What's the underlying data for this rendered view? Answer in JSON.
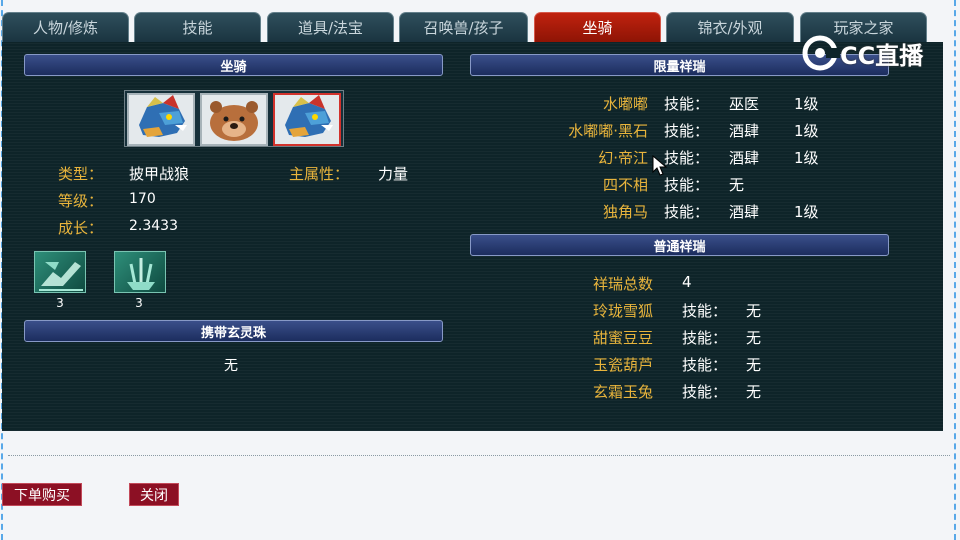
{
  "tabs": [
    {
      "label": "人物/修炼"
    },
    {
      "label": "技能"
    },
    {
      "label": "道具/法宝"
    },
    {
      "label": "召唤兽/孩子"
    },
    {
      "label": "坐骑",
      "active": true
    },
    {
      "label": "锦衣/外观"
    },
    {
      "label": "玩家之家"
    }
  ],
  "logo": {
    "text": "CC直播",
    "icon": "cc-logo-icon"
  },
  "mount_section": {
    "header": "坐骑",
    "mount_icons": [
      "dragon-wolf-portrait-icon",
      "bear-portrait-icon",
      "dragon-wolf-portrait-icon"
    ],
    "type_label": "类型：",
    "type_value": "披甲战狼",
    "main_attr_label": "主属性：",
    "main_attr_value": "力量",
    "level_label": "等级：",
    "level_value": "170",
    "growth_label": "成长：",
    "growth_value": "2.3433",
    "skills": [
      {
        "icon": "mount-skill-1-icon",
        "count": "3"
      },
      {
        "icon": "mount-skill-2-icon",
        "count": "3"
      }
    ]
  },
  "xuanling_section": {
    "header": "携带玄灵珠",
    "value": "无"
  },
  "limited_section": {
    "header": "限量祥瑞",
    "rows": [
      {
        "name": "水嘟嘟",
        "skill_label": "技能：",
        "skill": "巫医",
        "level": "1级"
      },
      {
        "name": "水嘟嘟·黑石",
        "skill_label": "技能：",
        "skill": "酒肆",
        "level": "1级"
      },
      {
        "name": "幻·帝江",
        "skill_label": "技能：",
        "skill": "酒肆",
        "level": "1级"
      },
      {
        "name": "四不相",
        "skill_label": "技能：",
        "skill": "无",
        "level": ""
      },
      {
        "name": "独角马",
        "skill_label": "技能：",
        "skill": "酒肆",
        "level": "1级"
      }
    ]
  },
  "normal_section": {
    "header": "普通祥瑞",
    "total_label": "祥瑞总数",
    "total_value": "4",
    "rows": [
      {
        "name": "玲珑雪狐",
        "skill_label": "技能：",
        "skill": "无"
      },
      {
        "name": "甜蜜豆豆",
        "skill_label": "技能：",
        "skill": "无"
      },
      {
        "name": "玉瓷葫芦",
        "skill_label": "技能：",
        "skill": "无"
      },
      {
        "name": "玄霜玉兔",
        "skill_label": "技能：",
        "skill": "无"
      }
    ]
  },
  "buttons": {
    "buy": "下单购买",
    "close": "关闭"
  }
}
